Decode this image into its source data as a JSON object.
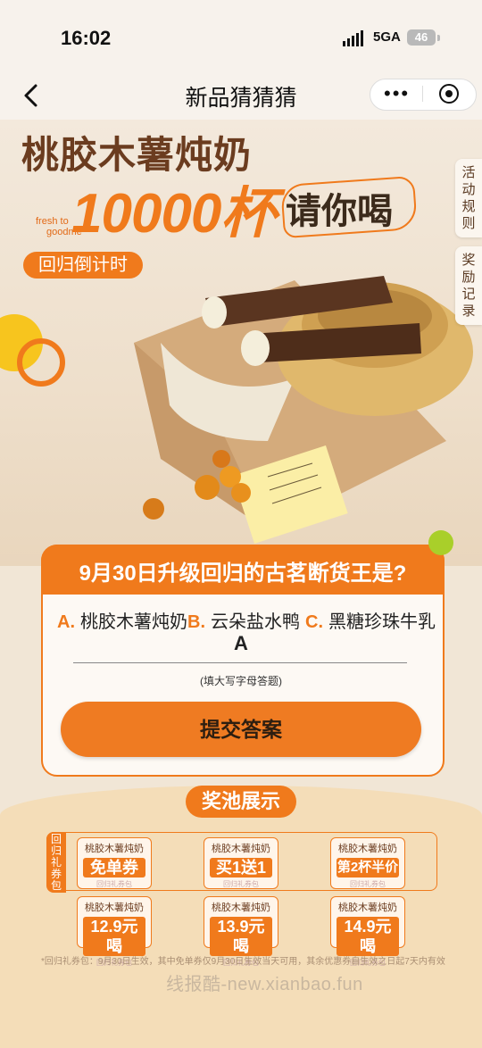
{
  "status_bar": {
    "time": "16:02",
    "network": "5GA",
    "battery": "46"
  },
  "nav": {
    "title": "新品猜猜猜"
  },
  "hero": {
    "title": "桃胶木薯炖奶",
    "count": "10000杯",
    "invite": "请你喝",
    "brand_line1": "fresh to",
    "brand_line2": "goodme",
    "countdown": "回归倒计时",
    "side_tabs": [
      "活动规则",
      "奖励记录"
    ]
  },
  "quiz": {
    "question": "9月30日升级回归的古茗断货王是?",
    "options": [
      {
        "letter": "A.",
        "text": "桃胶木薯炖奶"
      },
      {
        "letter": "B.",
        "text": "云朵盐水鸭"
      },
      {
        "letter": "C.",
        "text": "黑糖珍珠牛乳"
      }
    ],
    "answer_value": "A",
    "hint": "(填大写字母答题)",
    "submit_label": "提交答案"
  },
  "prize_pool": {
    "title": "奖池展示",
    "group_label": "回归礼券包",
    "coupons": [
      {
        "name": "桃胶木薯炖奶",
        "value": "免单券"
      },
      {
        "name": "桃胶木薯炖奶",
        "value": "买1送1"
      },
      {
        "name": "桃胶木薯炖奶",
        "value": "第2杯半价"
      },
      {
        "name": "桃胶木薯炖奶",
        "value": "12.9元喝"
      },
      {
        "name": "桃胶木薯炖奶",
        "value": "13.9元喝"
      },
      {
        "name": "桃胶木薯炖奶",
        "value": "14.9元喝"
      }
    ],
    "coupon_footer": "回归礼券包",
    "note": "*回归礼券包：9月30日生效，其中免单券仅9月30日生效当天可用，其余优惠券自生效之日起7天内有效"
  },
  "watermark": "线报酷-new.xianbao.fun",
  "colors": {
    "accent": "#f07a1c",
    "title_brown": "#6b3c1f",
    "green": "#a9cf2a"
  }
}
